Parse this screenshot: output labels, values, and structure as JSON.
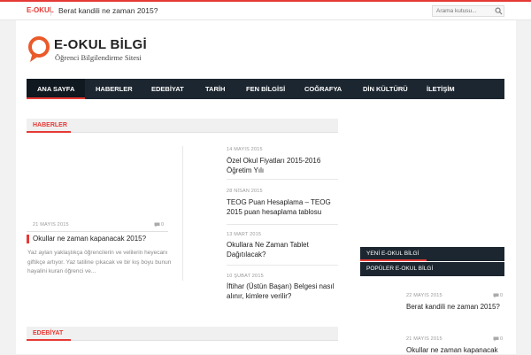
{
  "topbar": {
    "tag": "E-OKUL",
    "ticker": "Berat kandili ne zaman 2015?",
    "search_placeholder": "Arama kutusu..."
  },
  "logo": {
    "title": "E-OKUL BİLGİ",
    "subtitle": "Öğrenci Bilgilendirme Sitesi"
  },
  "nav": {
    "items": [
      "ANA SAYFA",
      "HABERLER",
      "EDEBİYAT",
      "TARİH",
      "FEN BİLGİSİ",
      "COĞRAFYA",
      "DİN KÜLTÜRÜ",
      "İLETİŞİM"
    ]
  },
  "sections": {
    "haberler": "HABERLER",
    "edebiyat": "EDEBİYAT"
  },
  "featured": {
    "date": "21 MAYIS 2015",
    "comments": "0",
    "title": "Okullar ne zaman kapanacak 2015?",
    "excerpt": "Yaz ayları yaklaştıkça öğrencilerin ve velilerin heyecanı giftikçe artıyor. Yaz tatiline çıkacak ve bir kış boyu bunun hayalini kuran öğrenci ve..."
  },
  "news_list": [
    {
      "date": "14 MAYIS 2015",
      "title": "Özel Okul Fiyatları 2015-2016 Öğretim Yılı"
    },
    {
      "date": "28 NİSAN 2015",
      "title": "TEOG Puan Hesaplama – TEOG 2015 puan hesaplama tablosu"
    },
    {
      "date": "13 MART 2015",
      "title": "Okullara Ne Zaman Tablet Dağıtılacak?"
    },
    {
      "date": "10 ŞUBAT 2015",
      "title": "İftihar (Üstün Başarı) Belgesi nasıl alınır, kimlere verilir?"
    }
  ],
  "sidebar": {
    "tab1": "YENİ E-OKUL BİLGİ",
    "tab2": "POPÜLER E-OKUL BİLGİ",
    "posts": [
      {
        "date": "22 MAYIS 2015",
        "comments": "0",
        "title": "Berat kandili ne zaman 2015?"
      },
      {
        "date": "21 MAYIS 2015",
        "comments": "0",
        "title": "Okullar ne zaman kapanacak"
      }
    ]
  },
  "colors": {
    "accent": "#e53935",
    "nav_bg": "#1c2630"
  }
}
